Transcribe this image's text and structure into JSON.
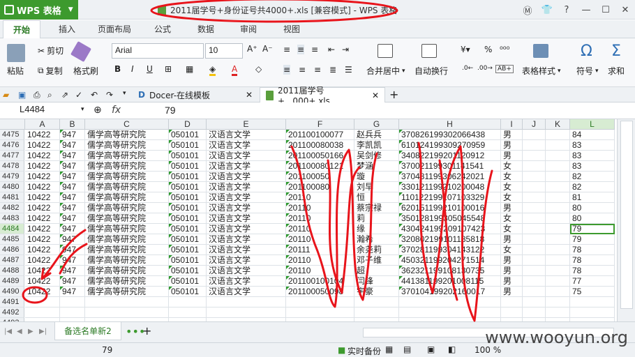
{
  "app": {
    "name": "WPS 表格",
    "title": "2011届学号+身份证号共4000+.xls [兼容模式] - WPS 表格"
  },
  "ribbon_tabs": [
    "开始",
    "插入",
    "页面布局",
    "公式",
    "数据",
    "审阅",
    "视图"
  ],
  "ribbon": {
    "paste": "粘贴",
    "cut": "剪切",
    "copy": "复制",
    "format_painter": "格式刷",
    "font_name": "Arial",
    "font_size": "10",
    "merge": "合并居中",
    "wrap": "自动换行",
    "number_format": "%",
    "table_style": "表格样式",
    "symbol": "符号",
    "sum": "求和"
  },
  "doc_tabs": [
    {
      "label": "Docer-在线模板"
    },
    {
      "label": "2011届学号+...000+.xls"
    }
  ],
  "name_box": "L4484",
  "formula_value": "79",
  "columns": [
    "A",
    "B",
    "C",
    "D",
    "E",
    "F",
    "G",
    "H",
    "I",
    "J",
    "K",
    "L"
  ],
  "selected_column": "L",
  "selected_row": "4484",
  "rows": [
    {
      "n": "4475",
      "a": "10422",
      "b": "947",
      "c": "儒学高等研究院",
      "d": "050101",
      "e": "汉语言文学",
      "f": "201100100077",
      "g": "赵兵兵",
      "h": "370826199302066438",
      "i": "男",
      "l": "84"
    },
    {
      "n": "4476",
      "a": "10422",
      "b": "947",
      "c": "儒学高等研究院",
      "d": "050101",
      "e": "汉语言文学",
      "f": "201100080038",
      "g": "李凯凯",
      "h": "610124199309270959",
      "i": "男",
      "l": "83"
    },
    {
      "n": "4477",
      "a": "10422",
      "b": "947",
      "c": "儒学高等研究院",
      "d": "050101",
      "e": "汉语言文学",
      "f": "201100050166",
      "g": "吴剑修",
      "h": "340822199201120912",
      "i": "男",
      "l": "83"
    },
    {
      "n": "4478",
      "a": "10422",
      "b": "947",
      "c": "儒学高等研究院",
      "d": "050101",
      "e": "汉语言文学",
      "f": "201100080121",
      "g": "梦涵",
      "h": "370021199301141541",
      "i": "女",
      "l": "83"
    },
    {
      "n": "4479",
      "a": "10422",
      "b": "947",
      "c": "儒学高等研究院",
      "d": "050101",
      "e": "汉语言文学",
      "f": "201100050",
      "g": "璇",
      "h": "370481199306242021",
      "i": "女",
      "l": "82"
    },
    {
      "n": "4480",
      "a": "10422",
      "b": "947",
      "c": "儒学高等研究院",
      "d": "050101",
      "e": "汉语言文学",
      "f": "201100080",
      "g": "刘早",
      "h": "330121199210200048",
      "i": "女",
      "l": "82"
    },
    {
      "n": "4481",
      "a": "10422",
      "b": "947",
      "c": "儒学高等研究院",
      "d": "050101",
      "e": "汉语言文学",
      "f": "20110",
      "g": "恒",
      "h": "110122199107103329",
      "i": "女",
      "l": "81"
    },
    {
      "n": "4482",
      "a": "10422",
      "b": "947",
      "c": "儒学高等研究院",
      "d": "050101",
      "e": "汉语言文学",
      "f": "20110",
      "g": "蔡宗禄",
      "h": "620151199210100016",
      "i": "男",
      "l": "80"
    },
    {
      "n": "4483",
      "a": "10422",
      "b": "947",
      "c": "儒学高等研究院",
      "d": "050101",
      "e": "汉语言文学",
      "f": "20110",
      "g": "莉",
      "h": "350128199305045548",
      "i": "女",
      "l": "80"
    },
    {
      "n": "4484",
      "a": "10422",
      "b": "947",
      "c": "儒学高等研究院",
      "d": "050101",
      "e": "汉语言文学",
      "f": "20110",
      "g": "缘",
      "h": "430424199209107423",
      "i": "女",
      "l": "79"
    },
    {
      "n": "4485",
      "a": "10422",
      "b": "947",
      "c": "儒学高等研究院",
      "d": "050101",
      "e": "汉语言文学",
      "f": "20110",
      "g": "瀚希",
      "h": "320802199101185818",
      "i": "男",
      "l": "79"
    },
    {
      "n": "4486",
      "a": "10422",
      "b": "947",
      "c": "儒学高等研究院",
      "d": "050101",
      "e": "汉语言文学",
      "f": "20111",
      "g": "余尧莉",
      "h": "370281199304143122",
      "i": "女",
      "l": "78"
    },
    {
      "n": "4487",
      "a": "10422",
      "b": "947",
      "c": "儒学高等研究院",
      "d": "050101",
      "e": "汉语言文学",
      "f": "20110",
      "g": "邓子维",
      "h": "450321199204271514",
      "i": "男",
      "l": "78"
    },
    {
      "n": "4488",
      "a": "10422",
      "b": "947",
      "c": "儒学高等研究院",
      "d": "050101",
      "e": "汉语言文学",
      "f": "20110",
      "g": "超",
      "h": "362321199108130735",
      "i": "男",
      "l": "78"
    },
    {
      "n": "4489",
      "a": "10422",
      "b": "947",
      "c": "儒学高等研究院",
      "d": "050101",
      "e": "汉语言文学",
      "f": "201100100104",
      "g": "闫锋",
      "h": "441381199201008115",
      "i": "男",
      "l": "77"
    },
    {
      "n": "4490",
      "a": "10422",
      "b": "947",
      "c": "儒学高等研究院",
      "d": "050101",
      "e": "汉语言文学",
      "f": "201100050098",
      "g": "宇豪",
      "h": "370104199202160017",
      "i": "男",
      "l": "75"
    },
    {
      "n": "4491",
      "a": "",
      "b": "",
      "c": "",
      "d": "",
      "e": "",
      "f": "",
      "g": "",
      "h": "",
      "i": "",
      "l": ""
    },
    {
      "n": "4492",
      "a": "",
      "b": "",
      "c": "",
      "d": "",
      "e": "",
      "f": "",
      "g": "",
      "h": "",
      "i": "",
      "l": ""
    },
    {
      "n": "4493",
      "a": "",
      "b": "",
      "c": "",
      "d": "",
      "e": "",
      "f": "",
      "g": "",
      "h": "",
      "i": "",
      "l": ""
    }
  ],
  "sheet_tab": "备选名单新2",
  "status": {
    "value": "79",
    "backup": "实时备份",
    "zoom": "100 %"
  },
  "watermark": "www.wooyun.org",
  "annotation_color": "#e8141b"
}
